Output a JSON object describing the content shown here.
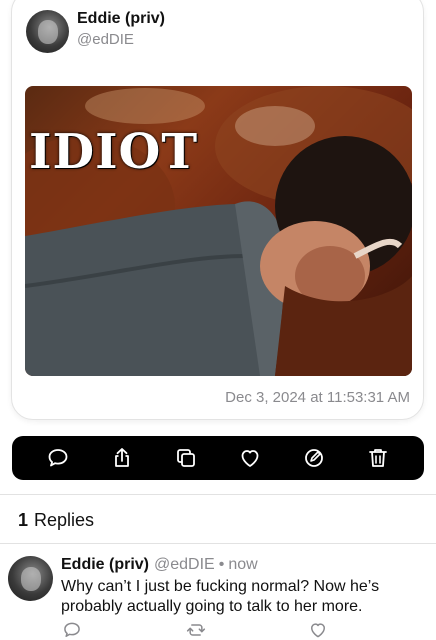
{
  "post": {
    "author_name": "Eddie (priv)",
    "author_handle": "@edDIE",
    "media_caption": "IDIOT",
    "timestamp": "Dec 3, 2024 at 11:53:31 AM"
  },
  "actions": {
    "icons": [
      "comment-icon",
      "share-icon",
      "copy-icon",
      "heart-icon",
      "edit-icon",
      "trash-icon"
    ],
    "color": "#ffffff",
    "bar_color": "#000000"
  },
  "replies": {
    "count": "1",
    "label": "Replies",
    "items": [
      {
        "author_name": "Eddie (priv)",
        "author_handle": "@edDIE",
        "separator": "•",
        "time": "now",
        "text": "Why can’t I just be fucking normal? Now he’s probably actually going to talk to her more."
      }
    ]
  },
  "colors": {
    "secondary_text": "#8a8a8e",
    "action_icon_gray": "#8a8a8e"
  }
}
